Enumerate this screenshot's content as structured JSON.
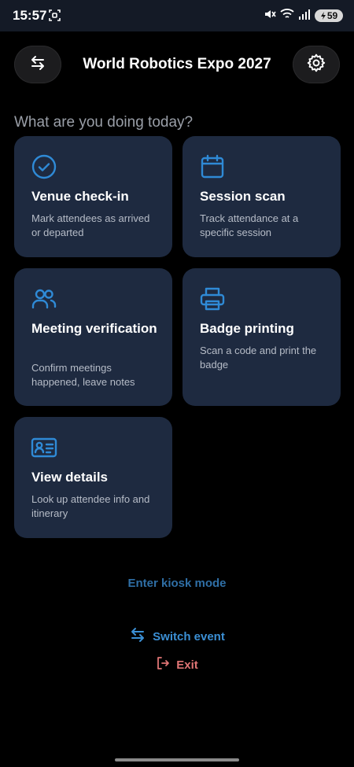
{
  "status": {
    "time": "15:57",
    "battery": "59"
  },
  "header": {
    "title": "World Robotics Expo 2027"
  },
  "prompt": "What are you doing today?",
  "cards": [
    {
      "title": "Venue check-in",
      "description": "Mark attendees as arrived or departed",
      "icon": "check-circle-icon"
    },
    {
      "title": "Session scan",
      "description": "Track attendance at a specific session",
      "icon": "calendar-icon"
    },
    {
      "title": "Meeting verification",
      "description": "Confirm meetings happened, leave notes",
      "icon": "people-icon"
    },
    {
      "title": "Badge printing",
      "description": "Scan a code and print the badge",
      "icon": "printer-icon"
    },
    {
      "title": "View details",
      "description": "Look up attendee info and itinerary",
      "icon": "id-card-icon"
    }
  ],
  "actions": {
    "kiosk_label": "Enter kiosk mode",
    "switch_label": "Switch event",
    "exit_label": "Exit"
  },
  "colors": {
    "accent": "#2f8ad6",
    "card_bg": "#1e2a40",
    "exit": "#e07575"
  }
}
